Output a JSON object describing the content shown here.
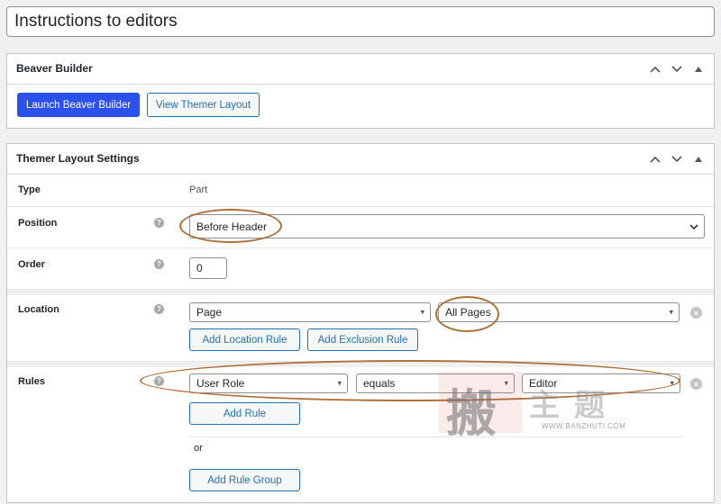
{
  "post_title": "Instructions to editors",
  "beaver_builder": {
    "title": "Beaver Builder",
    "launch_label": "Launch Beaver Builder",
    "view_label": "View Themer Layout"
  },
  "settings": {
    "title": "Themer Layout Settings",
    "type_label": "Type",
    "type_value": "Part",
    "position_label": "Position",
    "position_value": "Before Header",
    "order_label": "Order",
    "order_value": "0",
    "location_label": "Location",
    "location_select": "Page",
    "location_sub_select": "All Pages",
    "add_location_rule": "Add Location Rule",
    "add_exclusion_rule": "Add Exclusion Rule",
    "rules_label": "Rules",
    "rule_field": "User Role",
    "rule_operator": "equals",
    "rule_value": "Editor",
    "add_rule": "Add Rule",
    "or_text": "or",
    "add_rule_group": "Add Rule Group"
  },
  "icons": {
    "help": "?",
    "remove": "×",
    "up": "chevron-up-icon",
    "down": "chevron-down-icon",
    "toggle": "triangle-up-icon"
  },
  "watermark": {
    "chars": "搬主题",
    "url": "WWW.BANZHUTI.COM"
  },
  "colors": {
    "accent": "#2b50ec",
    "link": "#2271b1",
    "annotation": "#b0703a"
  }
}
